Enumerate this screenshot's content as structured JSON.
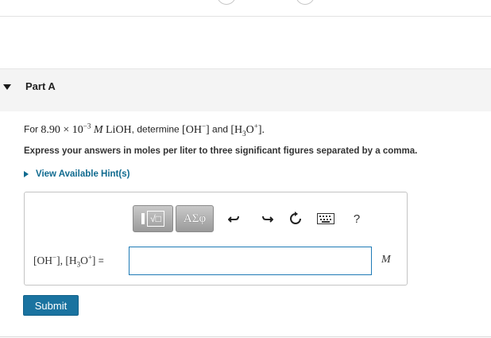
{
  "part": {
    "title": "Part A"
  },
  "question": {
    "prefix": "For ",
    "concentration": "8.90",
    "times": " × 10",
    "exponent": "−3",
    "unit": " M",
    "compound": " LiOH",
    "verb": ", determine ",
    "oh_ion": "[OH",
    "oh_charge": "−",
    "oh_close": "]",
    "conj": " and ",
    "h3o_open": "[H",
    "h3o_sub": "3",
    "h3o_o": "O",
    "h3o_charge": "+",
    "h3o_close": "].",
    "instruction": "Express your answers in moles per liter to three significant figures separated by a comma."
  },
  "hint": {
    "label": "View Available Hint(s)"
  },
  "toolbar": {
    "template_root": "√□",
    "symbols_label": "ΑΣφ",
    "help_label": "?",
    "icons": [
      "undo-icon",
      "redo-icon",
      "reset-icon",
      "keyboard-icon",
      "help-icon"
    ]
  },
  "answer": {
    "label_oh": "[OH",
    "label_oh_charge": "−",
    "label_sep": "], [H",
    "label_sub": "3",
    "label_o": "O",
    "label_charge": "+",
    "label_end": "]",
    "equals": " =",
    "value": "",
    "unit": "M"
  },
  "submit": {
    "label": "Submit"
  },
  "colors": {
    "accent": "#1a73a0",
    "link": "#0f6a8f",
    "input_border": "#1f7bb6",
    "header_bg": "#f4f4f4"
  }
}
